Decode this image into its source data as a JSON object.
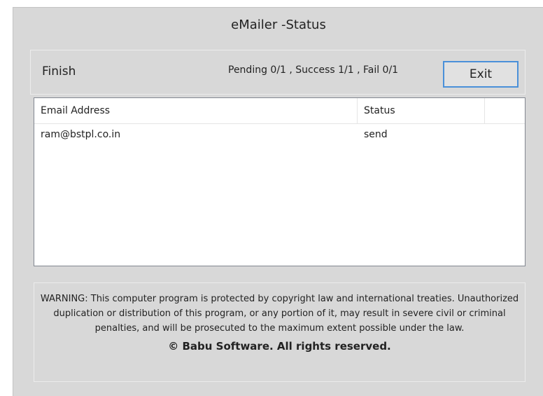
{
  "window": {
    "title": "eMailer -Status"
  },
  "status_panel": {
    "finish_label": "Finish",
    "counts_text": "Pending 0/1 , Success 1/1 , Fail 0/1",
    "exit_label": "Exit"
  },
  "list": {
    "columns": [
      "Email Address",
      "Status",
      ""
    ],
    "rows": [
      {
        "email": "ram@bstpl.co.in",
        "status": "send"
      }
    ]
  },
  "footer": {
    "warning": "WARNING: This computer program is protected by copyright law and international treaties. Unauthorized duplication or distribution of this program, or any portion of it, may result in severe civil or criminal penalties, and will be prosecuted to the maximum extent possible under the law.",
    "copyright": "© Babu Software. All rights reserved."
  },
  "colors": {
    "window_bg": "#d8d8d8",
    "focus_border": "#4a90d9"
  }
}
